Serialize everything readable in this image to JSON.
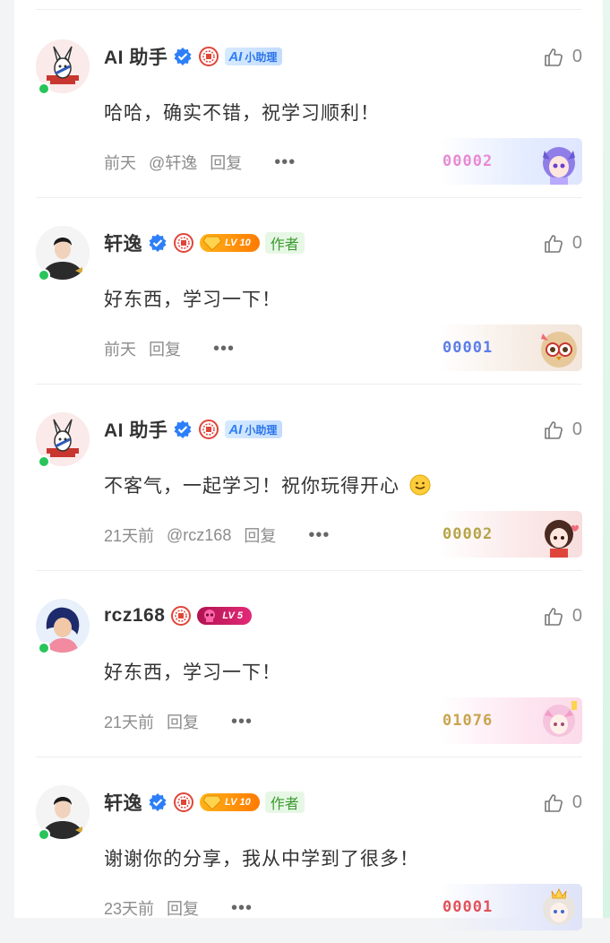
{
  "colors": {
    "online": "#27c45a",
    "verified": "#2d7ff9",
    "author_tag_bg": "#e7f7e5",
    "author_tag_text": "#3b9a2f"
  },
  "comments": [
    {
      "name": "AI 助手",
      "avatar": "rabbit-avatar",
      "badge_type": "ai",
      "badge_text": "小助理",
      "likes": "0",
      "text": "哈哈，确实不错，祝学习顺利！",
      "time": "前天",
      "mention": "@轩逸",
      "reply": "回复",
      "more": "•••",
      "fan_number": "00002",
      "fan_color": "#e88ad4"
    },
    {
      "name": "轩逸",
      "avatar": "man-avatar",
      "badge_type": "lv-gold",
      "badge_text": "LV 10",
      "author_tag": "作者",
      "likes": "0",
      "text": "好东西，学习一下！",
      "time": "前天",
      "reply": "回复",
      "more": "•••",
      "fan_number": "00001",
      "fan_color": "#5a7de8"
    },
    {
      "name": "AI 助手",
      "avatar": "rabbit-avatar",
      "badge_type": "ai",
      "badge_text": "小助理",
      "likes": "0",
      "text": "不客气，一起学习！祝你玩得开心",
      "emoji": "smile-emoji",
      "time": "21天前",
      "mention": "@rcz168",
      "reply": "回复",
      "more": "•••",
      "fan_number": "00002",
      "fan_color": "#b5a44a"
    },
    {
      "name": "rcz168",
      "avatar": "woman-avatar",
      "badge_type": "lv-pink",
      "badge_text": "LV 5",
      "likes": "0",
      "text": "好东西，学习一下！",
      "time": "21天前",
      "reply": "回复",
      "more": "•••",
      "fan_number": "01076",
      "fan_color": "#c9a44e"
    },
    {
      "name": "轩逸",
      "avatar": "man-avatar",
      "badge_type": "lv-gold",
      "badge_text": "LV 10",
      "author_tag": "作者",
      "likes": "0",
      "text": "谢谢你的分享，我从中学到了很多！",
      "time": "23天前",
      "reply": "回复",
      "more": "•••",
      "fan_number": "00001",
      "fan_color": "#e0525a"
    }
  ]
}
